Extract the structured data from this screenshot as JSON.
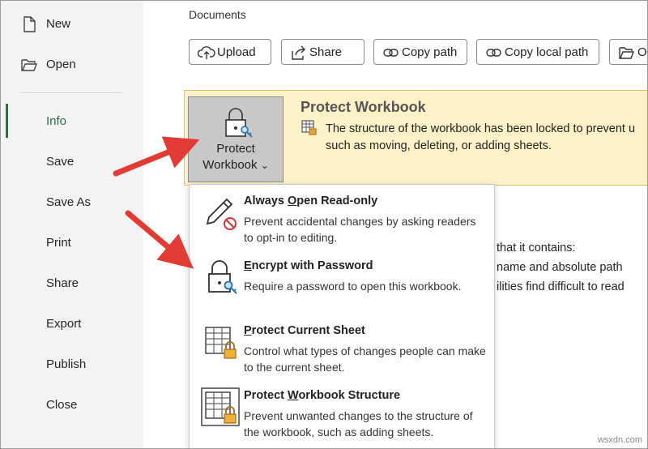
{
  "sidebar": {
    "items": [
      {
        "label": "New",
        "icon": "new-document-icon"
      },
      {
        "label": "Open",
        "icon": "open-folder-icon"
      },
      {
        "label": "Info"
      },
      {
        "label": "Save"
      },
      {
        "label": "Save As"
      },
      {
        "label": "Print"
      },
      {
        "label": "Share"
      },
      {
        "label": "Export"
      },
      {
        "label": "Publish"
      },
      {
        "label": "Close"
      }
    ],
    "active": "Info",
    "accent_color": "#217346"
  },
  "main": {
    "location": "Documents",
    "buttons": [
      {
        "label": "Upload",
        "icon": "upload-cloud-icon"
      },
      {
        "label": "Share",
        "icon": "share-arrow-icon"
      },
      {
        "label": "Copy path",
        "icon": "link-icon"
      },
      {
        "label": "Copy local path",
        "icon": "link-icon"
      },
      {
        "label": "O",
        "icon": "open-folder-icon"
      }
    ]
  },
  "protect": {
    "button_line1": "Protect",
    "button_line2": "Workbook",
    "caret": "⌄",
    "title": "Protect Workbook",
    "text_line1": "The structure of the workbook has been locked to prevent u",
    "text_line2": "such as moving, deleting, or adding sheets.",
    "banner_color": "#fdf2c7"
  },
  "background_text": [
    "that it contains:",
    "name and absolute path",
    "ilities find difficult to read"
  ],
  "menu": {
    "items": [
      {
        "title_pre": "Always ",
        "title_key": "O",
        "title_post": "pen Read-only",
        "desc": "Prevent accidental changes by asking readers to opt-in to editing.",
        "icon": "pencil-no-edit-icon"
      },
      {
        "title_pre": "",
        "title_key": "E",
        "title_post": "ncrypt with Password",
        "desc": "Require a password to open this workbook.",
        "icon": "lock-key-icon"
      },
      {
        "title_pre": "",
        "title_key": "P",
        "title_post": "rotect Current Sheet",
        "desc": "Control what types of changes people can make to the current sheet.",
        "icon": "sheet-lock-icon"
      },
      {
        "title_pre": "Protect ",
        "title_key": "W",
        "title_post": "orkbook Structure",
        "desc": "Prevent unwanted changes to the structure of the workbook, such as adding sheets.",
        "icon": "workbook-structure-lock-icon"
      }
    ]
  },
  "watermark": "wsxdn.com"
}
